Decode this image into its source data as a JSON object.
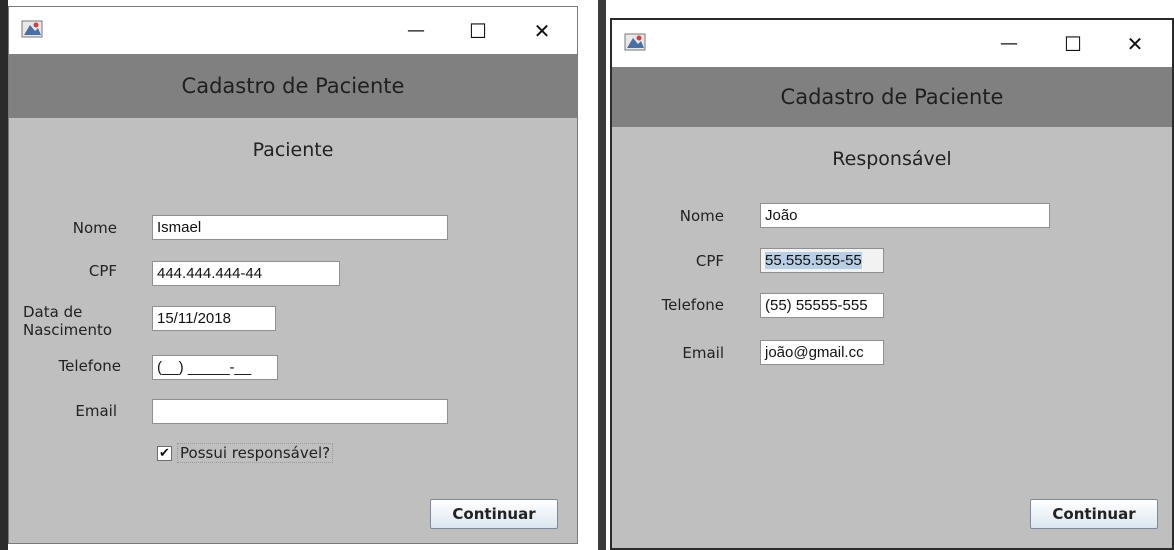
{
  "window_left": {
    "title_bar": {
      "minimize": "—",
      "maximize": "☐",
      "close": "✕"
    },
    "header_title": "Cadastro de Paciente",
    "section_title": "Paciente",
    "fields": {
      "nome": {
        "label": "Nome",
        "value": "Ismael"
      },
      "cpf": {
        "label": "CPF",
        "value": "444.444.444-44"
      },
      "data_nascimento": {
        "label_line1": "Data de",
        "label_line2": "Nascimento",
        "value": "15/11/2018"
      },
      "telefone": {
        "label": "Telefone",
        "value": "(__) _____-__"
      },
      "email": {
        "label": "Email",
        "value": ""
      }
    },
    "checkbox": {
      "label": "Possui responsável?",
      "checked": true,
      "mark": "✔"
    },
    "continue_button": "Continuar"
  },
  "window_right": {
    "title_bar": {
      "minimize": "—",
      "maximize": "☐",
      "close": "✕"
    },
    "header_title": "Cadastro de Paciente",
    "section_title": "Responsável",
    "fields": {
      "nome": {
        "label": "Nome",
        "value": "João"
      },
      "cpf": {
        "label": "CPF",
        "value": "55.555.555-55"
      },
      "telefone": {
        "label": "Telefone",
        "value": "(55) 55555-555"
      },
      "email": {
        "label": "Email",
        "value": "joão@gmail.cc"
      }
    },
    "continue_button": "Continuar"
  },
  "colors": {
    "window_bg": "#bfbfbf",
    "header_bg": "#808080",
    "titlebar_bg": "#ffffff"
  }
}
